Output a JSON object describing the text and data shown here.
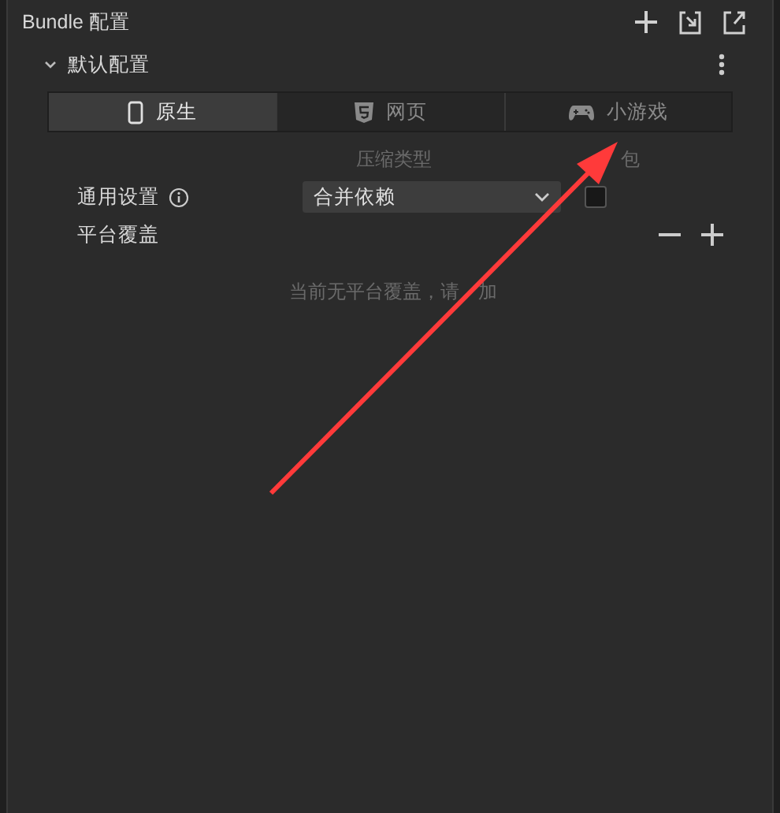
{
  "panel": {
    "title": "Bundle 配置"
  },
  "section": {
    "title": "默认配置",
    "expanded": true
  },
  "tabs": [
    {
      "label": "原生",
      "kind": "phone",
      "selected": true
    },
    {
      "label": "网页",
      "kind": "html5",
      "selected": false
    },
    {
      "label": "小游戏",
      "kind": "gamepad",
      "selected": false
    }
  ],
  "columns": [
    "压缩类型",
    "包"
  ],
  "general": {
    "label": "通用设置",
    "compression": "合并依赖",
    "remote": false
  },
  "platform_override": {
    "label": "平台覆盖",
    "empty_text_parts": [
      "当前无平台覆盖，请",
      "加"
    ]
  }
}
